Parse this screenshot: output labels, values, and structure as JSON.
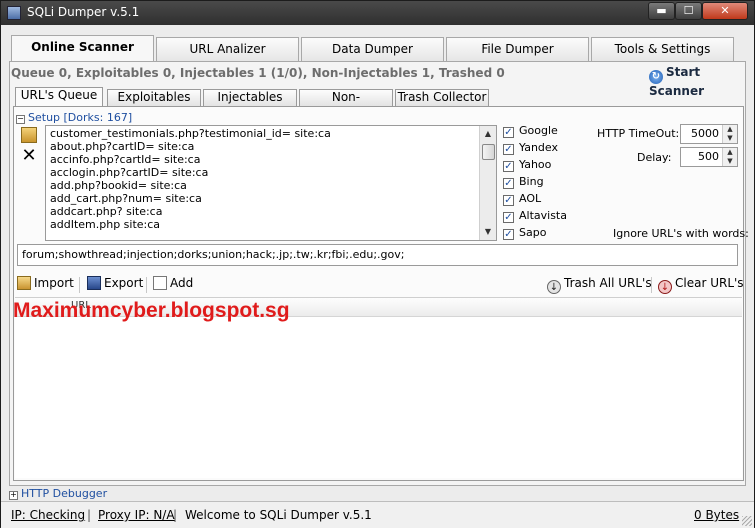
{
  "window": {
    "title": "SQLi Dumper v.5.1",
    "min": "▬",
    "max": "☐",
    "close": "✕"
  },
  "main_tabs": [
    {
      "label": "Online Scanner",
      "active": true
    },
    {
      "label": "URL Analizer",
      "active": false
    },
    {
      "label": "Data Dumper",
      "active": false
    },
    {
      "label": "File Dumper",
      "active": false
    },
    {
      "label": "Tools & Settings",
      "active": false
    }
  ],
  "status_line": "Queue 0, Exploitables 0, Injectables 1 (1/0), Non-Injectables 1, Trashed 0",
  "start_scanner": {
    "label": "Start Scanner",
    "icon": "refresh-icon"
  },
  "sub_tabs": [
    {
      "label": "URL's Queue",
      "active": true
    },
    {
      "label": "Exploitables",
      "active": false
    },
    {
      "label": "Injectables",
      "active": false
    },
    {
      "label": "Non-Injectables",
      "active": false
    },
    {
      "label": "Trash Collector",
      "active": false
    }
  ],
  "setup": {
    "toggle": "−",
    "label": "Setup [Dorks: 167]"
  },
  "dorks": [
    "customer_testimonials.php?testimonial_id= site:ca",
    "about.php?cartID= site:ca",
    "accinfo.php?cartId= site:ca",
    "acclogin.php?cartID= site:ca",
    "add.php?bookid= site:ca",
    "add_cart.php?num= site:ca",
    "addcart.php? site:ca",
    "addItem.php site:ca"
  ],
  "search_engines": [
    {
      "label": "Google",
      "checked": true
    },
    {
      "label": "Yandex",
      "checked": true
    },
    {
      "label": "Yahoo",
      "checked": true
    },
    {
      "label": "Bing",
      "checked": true
    },
    {
      "label": "AOL",
      "checked": true
    },
    {
      "label": "Altavista",
      "checked": true
    },
    {
      "label": "Sapo",
      "checked": true
    }
  ],
  "options": {
    "timeout_label": "HTTP TimeOut:",
    "timeout_value": "5000",
    "delay_label": "Delay:",
    "delay_value": "500",
    "ignore_label": "Ignore URL's with words:",
    "ignore_value": "forum;showthread;injection;dorks;union;hack;.jp;.tw;.kr;fbi;.edu;.gov;"
  },
  "toolbar": {
    "import": "Import",
    "export": "Export",
    "add": "Add",
    "trash_all": "Trash All URL's",
    "clear": "Clear URL's"
  },
  "grid": {
    "column": "URL"
  },
  "watermark": "Maximumcyber.blogspot.sg",
  "debugger": {
    "toggle": "+",
    "label": "HTTP Debugger"
  },
  "statusbar": {
    "ip": "IP:  Checking",
    "proxy": "Proxy IP: N/A",
    "welcome": "Welcome to SQLi Dumper v.5.1",
    "bytes": "0 Bytes",
    "sep": "|"
  }
}
